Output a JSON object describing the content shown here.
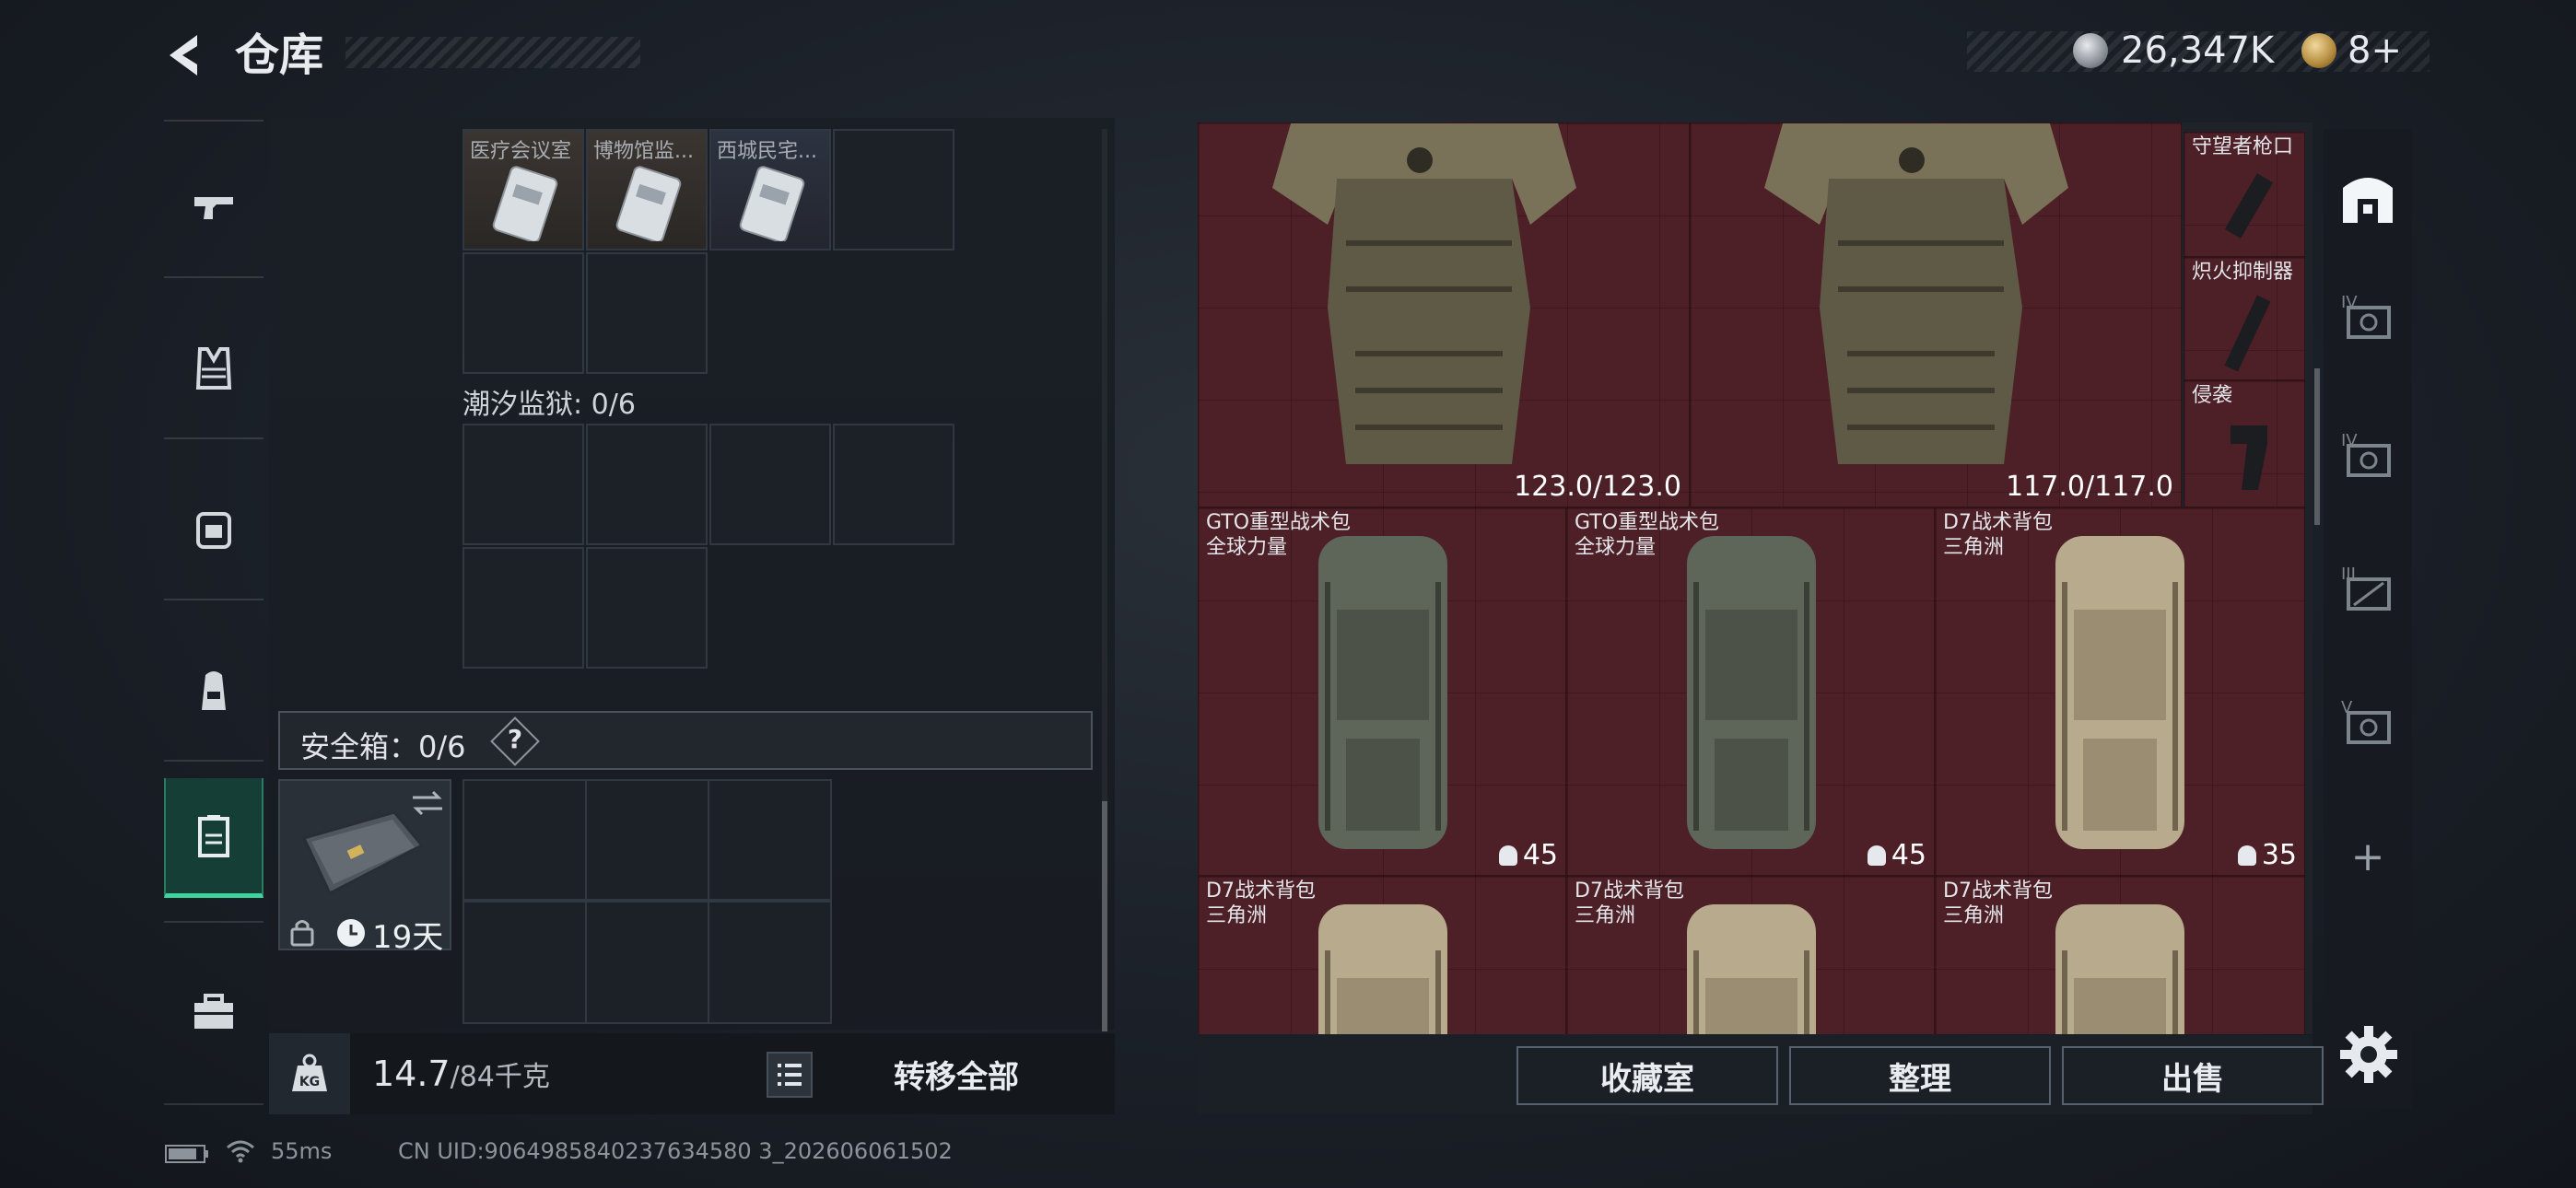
{
  "header": {
    "title": "仓库",
    "currency_value": "26,347K",
    "ticket_value": "8+"
  },
  "nav": {
    "items": [
      {
        "name": "pistol-icon"
      },
      {
        "name": "vest-icon"
      },
      {
        "name": "chest-rig-icon"
      },
      {
        "name": "backpack-icon"
      },
      {
        "name": "secure-case-icon"
      },
      {
        "name": "toolbox-icon"
      }
    ]
  },
  "left": {
    "key_cards": [
      {
        "label": "医疗会议室",
        "icon": "keycard-icon"
      },
      {
        "label": "博物馆监...",
        "icon": "keycard-icon"
      },
      {
        "label": "西城民宅...",
        "icon": "keycard-icon"
      }
    ],
    "prison_label": "潮汐监狱: 0/6",
    "safe_box_label": "安全箱：0/6",
    "safe_help": "?",
    "case_days": "19天",
    "weight_current": "14.7",
    "weight_max": "/84千克",
    "transfer_all": "转移全部"
  },
  "right": {
    "armor": [
      {
        "durability": "123.0/123.0",
        "icon": "body-armor-icon"
      },
      {
        "durability": "117.0/117.0",
        "icon": "body-armor-icon"
      }
    ],
    "attachments": [
      {
        "label": "守望者枪口",
        "icon": "muzzle-icon"
      },
      {
        "label": "炽火抑制器",
        "icon": "suppressor-icon"
      },
      {
        "label": "侵袭",
        "icon": "grip-icon"
      }
    ],
    "bags": [
      {
        "name": "GTO重型战术包",
        "faction": "全球力量",
        "capacity": "45",
        "color": "green"
      },
      {
        "name": "GTO重型战术包",
        "faction": "全球力量",
        "capacity": "45",
        "color": "green"
      },
      {
        "name": "D7战术背包",
        "faction": "三角洲",
        "capacity": "35",
        "color": "tan"
      },
      {
        "name": "D7战术背包",
        "faction": "三角洲",
        "capacity": "",
        "color": "tan"
      },
      {
        "name": "D7战术背包",
        "faction": "三角洲",
        "capacity": "",
        "color": "tan"
      },
      {
        "name": "D7战术背包",
        "faction": "三角洲",
        "capacity": "",
        "color": "tan"
      }
    ],
    "buttons": {
      "collection": "收藏室",
      "sort": "整理",
      "sell": "出售"
    }
  },
  "tabs": {
    "items": [
      {
        "name": "stash-home-icon"
      },
      {
        "name": "tier-iv-safe-icon"
      },
      {
        "name": "tier-iv-safe-icon"
      },
      {
        "name": "tier-iii-safe-icon"
      },
      {
        "name": "tier-v-safe-icon"
      }
    ],
    "plus": "+"
  },
  "status": {
    "ping": "55ms",
    "uid": "CN UID:9064985840237634580 3_202606061502"
  },
  "colors": {
    "accent": "#3fd39e",
    "slot_red": "#4d1f26",
    "panel": "#1a1f26"
  }
}
